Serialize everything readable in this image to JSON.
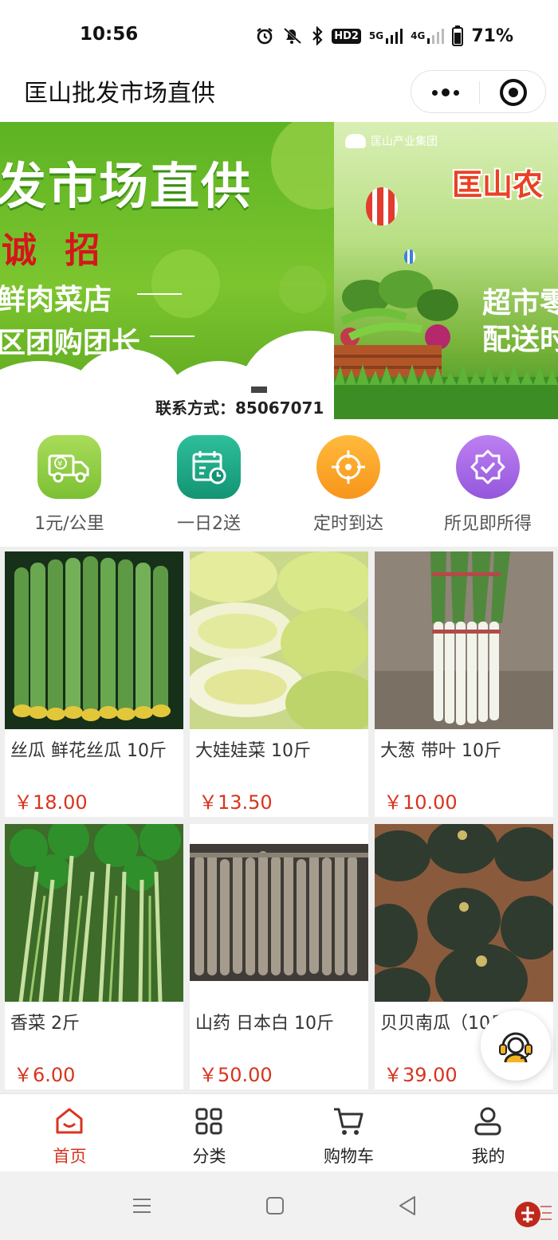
{
  "status_bar": {
    "time": "10:56",
    "hd_label": "HD2",
    "net_5g": "5G",
    "net_4g": "4G",
    "battery": "71%"
  },
  "header": {
    "title": "匡山批发市场直供",
    "more_icon": "more-dots-icon",
    "close_icon": "target-close-icon"
  },
  "banner": {
    "slide1": {
      "headline": "发市场直供",
      "recruit": "诚 招",
      "line1": "鲜肉菜店",
      "line2": "区团购团长",
      "contact_label": "联系方式：",
      "contact_phone": "85067071"
    },
    "slide2": {
      "group_name": "匡山产业集团",
      "brand": "匡山农",
      "line1": "超市零",
      "line2": "配送时"
    }
  },
  "features": [
    {
      "label": "1元/公里",
      "icon": "delivery-truck-icon",
      "color": "#8fcc3c"
    },
    {
      "label": "一日2送",
      "icon": "calendar-clock-icon",
      "color": "#1fa889"
    },
    {
      "label": "定时到达",
      "icon": "crosshair-target-icon",
      "color": "#f9a322"
    },
    {
      "label": "所见即所得",
      "icon": "verified-badge-icon",
      "color": "#a869e6"
    }
  ],
  "products": [
    {
      "name": "丝瓜 鲜花丝瓜 10斤",
      "price": "￥18.00",
      "image": "loofah-photo"
    },
    {
      "name": "大娃娃菜 10斤",
      "price": "￥13.50",
      "image": "baby-cabbage-photo"
    },
    {
      "name": "大葱 带叶 10斤",
      "price": "￥10.00",
      "image": "scallion-photo"
    },
    {
      "name": "香菜 2斤",
      "price": "￥6.00",
      "image": "coriander-photo"
    },
    {
      "name": "山药 日本白 10斤",
      "price": "￥50.00",
      "image": "yam-photo"
    },
    {
      "name": "贝贝南瓜（10斤装）",
      "price": "￥39.00",
      "image": "pumpkin-photo"
    }
  ],
  "service_icon": "customer-service-headset-icon",
  "tabs": [
    {
      "label": "首页",
      "icon": "home-icon",
      "active": true
    },
    {
      "label": "分类",
      "icon": "category-grid-icon",
      "active": false
    },
    {
      "label": "购物车",
      "icon": "cart-icon",
      "active": false
    },
    {
      "label": "我的",
      "icon": "profile-icon",
      "active": false
    }
  ],
  "colors": {
    "accent": "#d8341e",
    "banner_green": "#6ab529"
  },
  "watermark_icon": "site-logo-watermark"
}
